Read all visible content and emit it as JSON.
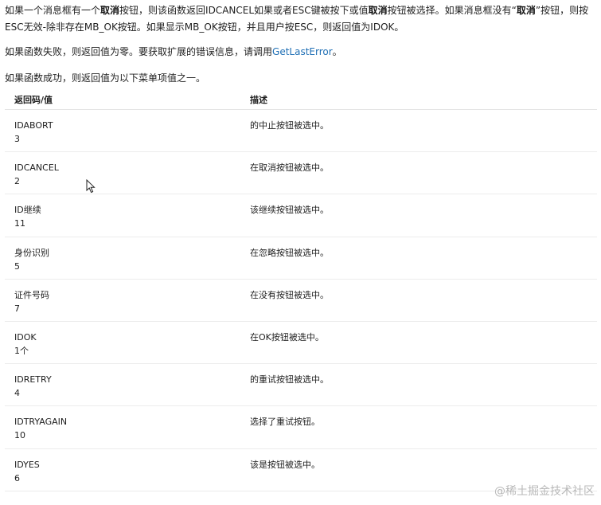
{
  "paragraphs": {
    "p1": {
      "s1": "如果一个消息框有一个",
      "b1": "取消",
      "s2": "按钮，则该函数返回IDCANCEL如果或者ESC键被按下或值",
      "b2": "取消",
      "s3": "按钮被选择。如果消息框没有“",
      "b3": "取消",
      "s4": "”按钮，则按ESC无效-除非存在MB_OK按钮。如果显示MB_OK按钮，并且用户按ESC，则返回值为IDOK。"
    },
    "p2": {
      "text": "如果函数失败，则返回值为零。要获取扩展的错误信息，请调用",
      "link": "GetLastError",
      "end": "。"
    },
    "p3": {
      "text": "如果函数成功，则返回值为以下菜单项值之一。"
    }
  },
  "table": {
    "headers": {
      "code": "返回码/值",
      "desc": "描述"
    },
    "rows": [
      {
        "code": "IDABORT",
        "value": "3",
        "desc": "的中止按钮被选中。"
      },
      {
        "code": "IDCANCEL",
        "value": "2",
        "desc": "在取消按钮被选中。"
      },
      {
        "code": "ID继续",
        "value": "11",
        "desc": "该继续按钮被选中。"
      },
      {
        "code": "身份识别",
        "value": "5",
        "desc": "在忽略按钮被选中。"
      },
      {
        "code": "证件号码",
        "value": "7",
        "desc": "在没有按钮被选中。"
      },
      {
        "code": "IDOK",
        "value": "1个",
        "desc": "在OK按钮被选中。"
      },
      {
        "code": "IDRETRY",
        "value": "4",
        "desc": "的重试按钮被选中。"
      },
      {
        "code": "IDTRYAGAIN",
        "value": "10",
        "desc": "选择了重试按钮。"
      },
      {
        "code": "IDYES",
        "value": "6",
        "desc": "该是按钮被选中。"
      }
    ]
  },
  "watermark": "@稀土掘金技术社区",
  "colors": {
    "link": "#1f6fb5",
    "text": "#1e1e1e",
    "watermark": "#b8b8b8"
  },
  "icons": {
    "cursor": "mouse-pointer-icon"
  }
}
